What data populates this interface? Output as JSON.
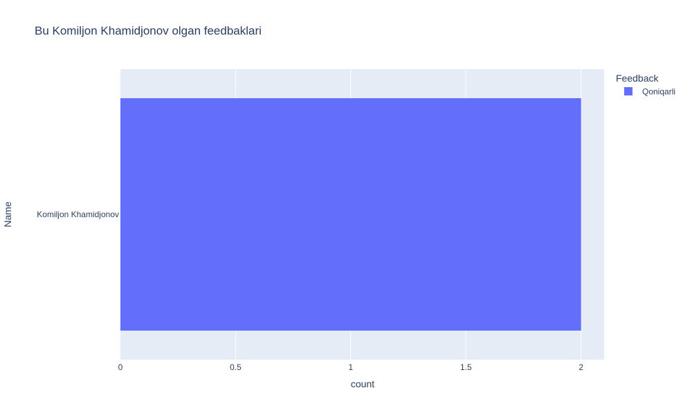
{
  "chart_data": {
    "type": "bar",
    "orientation": "horizontal",
    "title": "Bu Komiljon Khamidjonov olgan feedbaklari",
    "xlabel": "count",
    "ylabel": "Name",
    "categories": [
      "Komiljon Khamidjonov"
    ],
    "series": [
      {
        "name": "Qoniqarli",
        "values": [
          2
        ],
        "color": "#636efa"
      }
    ],
    "xlim": [
      0,
      2.1
    ],
    "xticks": [
      0,
      0.5,
      1,
      1.5,
      2
    ],
    "xtick_labels": [
      "0",
      "0.5",
      "1",
      "1.5",
      "2"
    ],
    "grid": true,
    "legend": {
      "title": "Feedback",
      "position": "top-right"
    },
    "plot_background": "#e5ecf6"
  }
}
